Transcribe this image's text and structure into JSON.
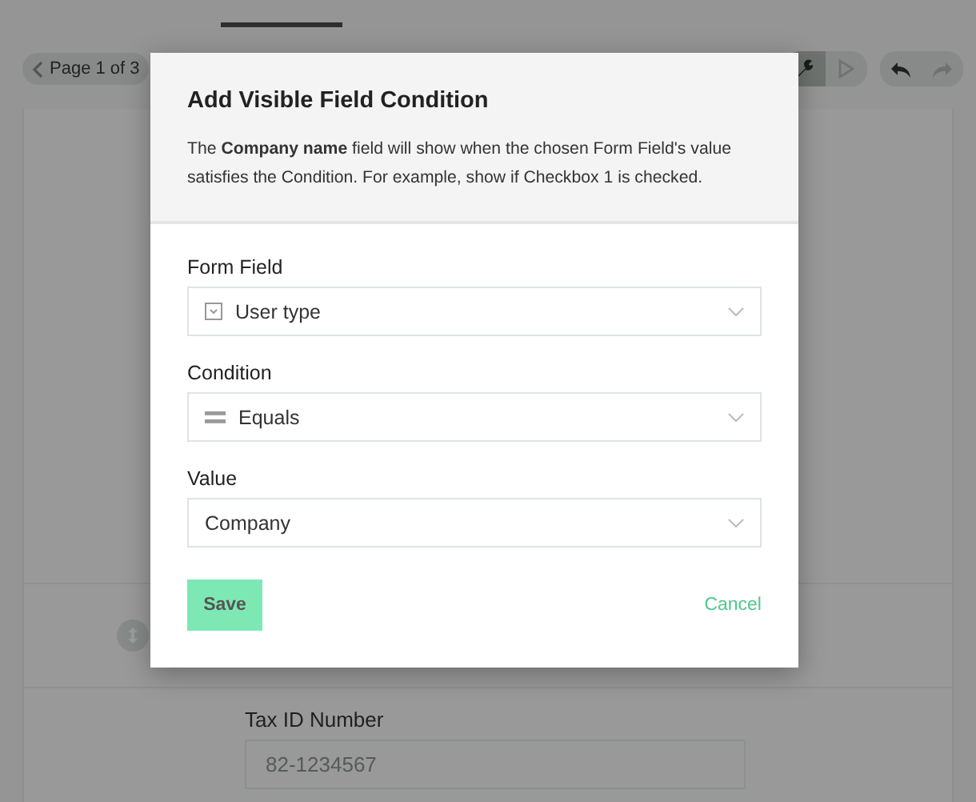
{
  "background": {
    "page_nav": {
      "label": "Page 1 of 3"
    },
    "tools": [
      {
        "kind": "wrench",
        "selected": true
      },
      {
        "kind": "play",
        "selected": false
      }
    ],
    "form": {
      "label": "Tax ID Number",
      "placeholder": "82-1234567"
    }
  },
  "dialog": {
    "title": "Add Visible Field Condition",
    "description": "The **Company name** field will show when the chosen Form Field's value satisfies the Condition. For example, show if Checkbox 1 is checked.",
    "fields": [
      {
        "label": "Form Field",
        "value": "User type",
        "kind": "dropdown"
      },
      {
        "label": "Condition",
        "value": "Equals",
        "kind": "equals"
      },
      {
        "label": "Value",
        "value": "Company",
        "kind": "plain"
      }
    ],
    "save": "Save",
    "cancel": "Cancel"
  }
}
